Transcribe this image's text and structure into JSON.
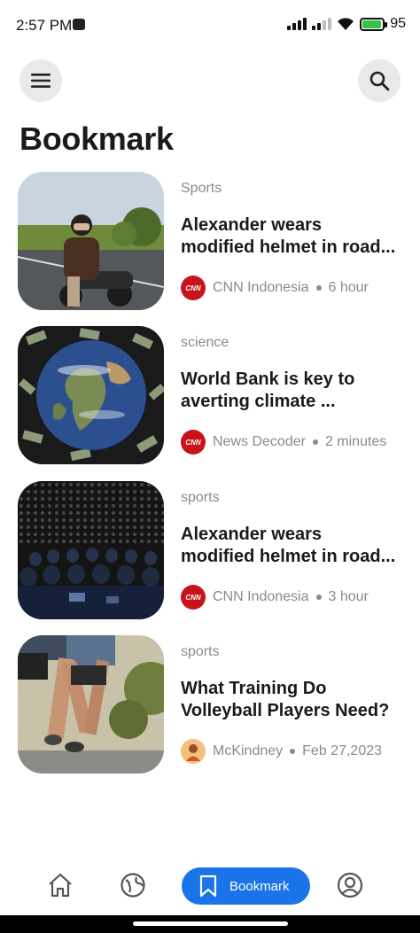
{
  "status_bar": {
    "time": "2:57 PM",
    "battery_percent": "95",
    "battery_level": 0.95,
    "battery_color": "#37c24a"
  },
  "header": {
    "menu_icon": "hamburger-menu-icon",
    "search_icon": "search-icon",
    "title": "Bookmark"
  },
  "articles": [
    {
      "category": "Sports",
      "title_line1": "Alexander wears",
      "title_line2": "modified helmet in road...",
      "source": "CNN Indonesia",
      "source_logo_text": "CNN",
      "time": "6 hour",
      "image": "motorcycle-rider-image"
    },
    {
      "category": "science",
      "title_line1": "World Bank is key to",
      "title_line2": "averting climate ...",
      "source": "News Decoder",
      "source_logo_text": "CNN",
      "time": "2 minutes",
      "image": "earth-money-image"
    },
    {
      "category": "sports",
      "title_line1": "Alexander wears",
      "title_line2": "modified helmet in road...",
      "source": "CNN Indonesia",
      "source_logo_text": "CNN",
      "time": "3 hour",
      "image": "audience-concert-image"
    },
    {
      "category": "sports",
      "title_line1": "What Training Do",
      "title_line2": "Volleyball Players Need?",
      "source": "McKindney",
      "source_logo_text": "",
      "time": "Feb 27,2023",
      "image": "runners-image"
    }
  ],
  "bottom_nav": {
    "home_icon": "home-icon",
    "explore_icon": "globe-icon",
    "bookmark_label": "Bookmark",
    "profile_icon": "profile-icon",
    "accent": "#1a73e8"
  }
}
